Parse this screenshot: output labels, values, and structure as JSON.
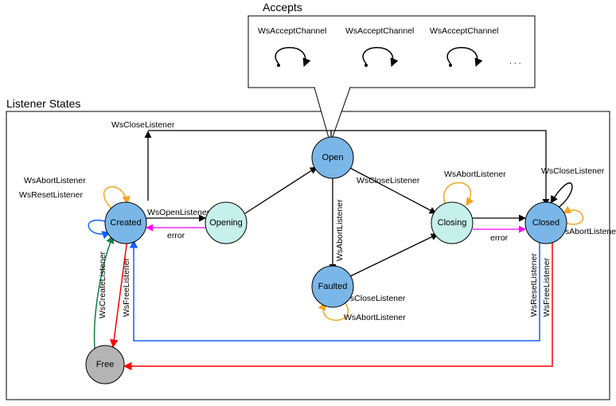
{
  "titles": {
    "accepts": "Accepts",
    "listenerStates": "Listener States"
  },
  "accepts": {
    "loopLabel": "WsAcceptChannel",
    "count": 3,
    "ellipsis": ". . ."
  },
  "nodes": {
    "created": "Created",
    "opening": "Opening",
    "open": "Open",
    "closing": "Closing",
    "closed": "Closed",
    "faulted": "Faulted",
    "free": "Free"
  },
  "edges": {
    "wsOpenListener": "WsOpenListener",
    "error_opening": "error",
    "wsCloseListener_top": "WsCloseListener",
    "wsCloseListener_open": "WsCloseListener",
    "wsCloseListener_faulted": "WsCloseListener",
    "wsCloseListener_loop": "WsCloseListener",
    "wsAbortListener_open": "WsAbortListener",
    "wsAbortListener_closing": "WsAbortListener",
    "wsAbortListener_faulted": "WsAbortListener",
    "wsAbortListener_closed": "WsAbortListener",
    "wsAbortListener_created": "WsAbortListener",
    "wsResetListener_closed": "WsResetListener",
    "wsResetListener_created": "WsResetListener",
    "error_closing": "error",
    "wsCreateListener": "WsCreateListener",
    "wsFreeListener_created": "WsFreeListener",
    "wsFreeListener_closed": "WsFreeListener"
  },
  "colors": {
    "black": "#000000",
    "magenta": "#ff00ff",
    "blue": "#1060ff",
    "red": "#ff0000",
    "green": "#108040",
    "orange": "#f5a623"
  },
  "chart_data": {
    "type": "state-diagram",
    "title": "Listener States",
    "states": [
      "Free",
      "Created",
      "Opening",
      "Open",
      "Closing",
      "Closed",
      "Faulted"
    ],
    "transitions": [
      {
        "from": "Free",
        "to": "Created",
        "label": "WsCreateListener"
      },
      {
        "from": "Created",
        "to": "Free",
        "label": "WsFreeListener"
      },
      {
        "from": "Created",
        "to": "Opening",
        "label": "WsOpenListener"
      },
      {
        "from": "Opening",
        "to": "Created",
        "label": "error"
      },
      {
        "from": "Opening",
        "to": "Open",
        "label": ""
      },
      {
        "from": "Open",
        "to": "Closing",
        "label": "WsCloseListener"
      },
      {
        "from": "Open",
        "to": "Faulted",
        "label": "WsAbortListener"
      },
      {
        "from": "Open",
        "to": "Closed",
        "label": "WsCloseListener"
      },
      {
        "from": "Faulted",
        "to": "Closing",
        "label": "WsCloseListener"
      },
      {
        "from": "Faulted",
        "to": "Faulted",
        "label": "WsAbortListener"
      },
      {
        "from": "Closing",
        "to": "Closed",
        "label": ""
      },
      {
        "from": "Closing",
        "to": "Closing",
        "label": "WsAbortListener"
      },
      {
        "from": "Closing",
        "to": "Closed",
        "label": "error"
      },
      {
        "from": "Closed",
        "to": "Closed",
        "label": "WsCloseListener"
      },
      {
        "from": "Closed",
        "to": "Closed",
        "label": "WsAbortListener"
      },
      {
        "from": "Closed",
        "to": "Created",
        "label": "WsResetListener"
      },
      {
        "from": "Closed",
        "to": "Free",
        "label": "WsFreeListener"
      },
      {
        "from": "Created",
        "to": "Created",
        "label": "WsAbortListener"
      },
      {
        "from": "Created",
        "to": "Created",
        "label": "WsResetListener"
      }
    ],
    "callout": {
      "on_state": "Open",
      "title": "Accepts",
      "loop_label": "WsAcceptChannel",
      "loop_count_shown": 3,
      "has_more": true
    }
  }
}
